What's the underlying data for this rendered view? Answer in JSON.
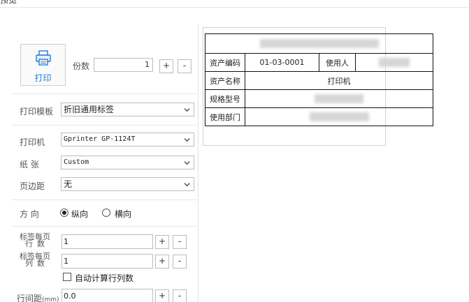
{
  "window": {
    "title": "预览"
  },
  "print_button": {
    "label": "打印",
    "icon": "printer-icon"
  },
  "copies": {
    "label": "份数",
    "value": "1",
    "plus": "+",
    "minus": "-"
  },
  "template": {
    "label": "打印模板",
    "value": "折旧通用标签"
  },
  "printer": {
    "label": "打印机",
    "value": "Gprinter GP-1124T"
  },
  "paper": {
    "label": "纸 张",
    "value": "Custom"
  },
  "margin": {
    "label": "页边距",
    "value": "无"
  },
  "orientation": {
    "label": "方 向",
    "options": [
      "纵向",
      "横向"
    ],
    "selected": "纵向"
  },
  "rows_per_page": {
    "label_line1": "标签每页",
    "label_line2": "行数",
    "value": "1"
  },
  "cols_per_page": {
    "label_line1": "标签每页",
    "label_line2": "列数",
    "value": "1"
  },
  "auto_calc": {
    "label": "自动计算行列数",
    "checked": false
  },
  "row_spacing": {
    "label": "行间距",
    "unit": "(mm)",
    "value": "0.0"
  },
  "preview": {
    "asset_code_label": "资产编码",
    "asset_code_value": "01-03-0001",
    "user_label": "使用人",
    "asset_name_label": "资产名称",
    "asset_name_value": "打印机",
    "model_label": "规格型号",
    "department_label": "使用部门"
  }
}
